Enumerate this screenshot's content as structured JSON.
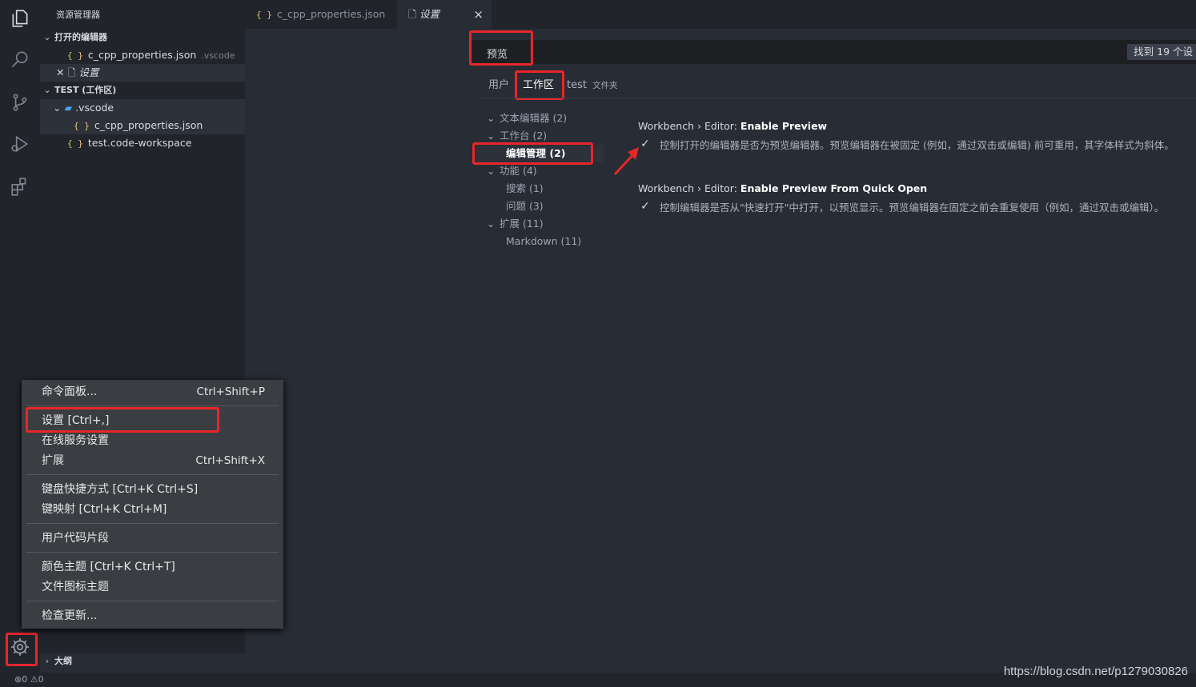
{
  "sidebar": {
    "title": "资源管理器",
    "open_editors_header": "打开的编辑器",
    "open_editors": [
      {
        "name": "c_cpp_properties.json",
        "hint": ".vscode",
        "icon": "{ }"
      },
      {
        "name": "设置"
      }
    ],
    "workspace_header": "TEST (工作区)",
    "tree": [
      {
        "name": ".vscode"
      },
      {
        "name": "c_cpp_properties.json",
        "icon": "{ }"
      },
      {
        "name": "test.code-workspace",
        "icon": "{ }"
      }
    ],
    "outline_header": "大纲"
  },
  "tabs": [
    {
      "label": "c_cpp_properties.json",
      "icon": "{ }"
    },
    {
      "label": "设置",
      "close": "×"
    }
  ],
  "settings": {
    "search_value": "预览",
    "result_count": "找到 19 个设",
    "scopes": [
      "用户",
      "工作区",
      "test"
    ],
    "folder_hint": "文件夹",
    "toc": [
      {
        "label": "文本编辑器 (2)"
      },
      {
        "label": "工作台 (2)"
      },
      {
        "label": "编辑管理 (2)"
      },
      {
        "label": "功能 (4)"
      },
      {
        "label": "搜索 (1)"
      },
      {
        "label": "问题 (3)"
      },
      {
        "label": "扩展 (11)"
      },
      {
        "label": "Markdown (11)"
      }
    ],
    "items": [
      {
        "category": "Workbench › Editor: ",
        "name": "Enable Preview",
        "description": "控制打开的编辑器是否为预览编辑器。预览编辑器在被固定 (例如，通过双击或编辑) 前可重用，其字体样式为斜体。",
        "checked": true
      },
      {
        "category": "Workbench › Editor: ",
        "name": "Enable Preview From Quick Open",
        "description": "控制编辑器是否从\"快速打开\"中打开，以预览显示。预览编辑器在固定之前会重复使用（例如，通过双击或编辑）。",
        "checked": true
      }
    ]
  },
  "menu": {
    "items": [
      {
        "label": "命令面板...",
        "shortcut": "Ctrl+Shift+P"
      },
      {
        "label": "设置 [Ctrl+,]",
        "shortcut": ""
      },
      {
        "label": "在线服务设置",
        "shortcut": ""
      },
      {
        "label": "扩展",
        "shortcut": "Ctrl+Shift+X"
      },
      {
        "label": "键盘快捷方式 [Ctrl+K Ctrl+S]",
        "shortcut": ""
      },
      {
        "label": "键映射 [Ctrl+K Ctrl+M]",
        "shortcut": ""
      },
      {
        "label": "用户代码片段",
        "shortcut": ""
      },
      {
        "label": "颜色主题 [Ctrl+K Ctrl+T]",
        "shortcut": ""
      },
      {
        "label": "文件图标主题",
        "shortcut": ""
      },
      {
        "label": "检查更新...",
        "shortcut": ""
      }
    ]
  },
  "status": {
    "errors": "0",
    "warnings": "0"
  },
  "watermark": "https://blog.csdn.net/p1279030826",
  "colors": {
    "annotation_red": "#e8262a",
    "background": "#282c34",
    "sidebar": "#21252b"
  }
}
